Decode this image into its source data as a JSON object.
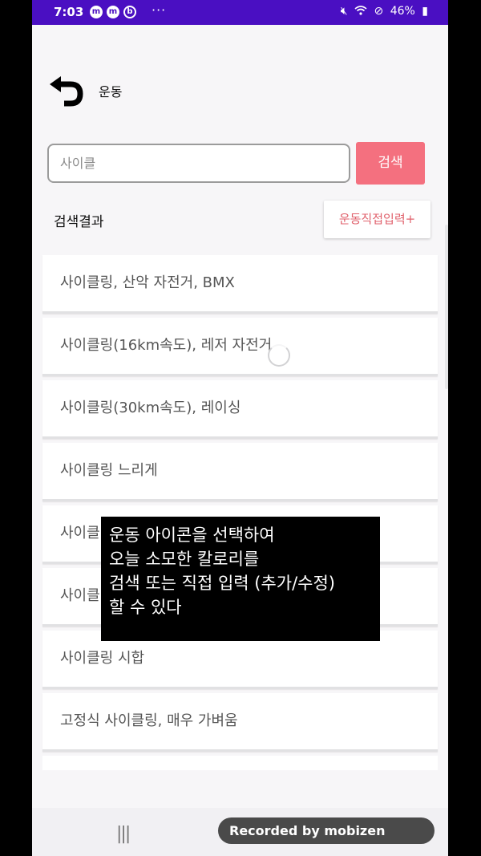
{
  "status_bar": {
    "time": "7:03",
    "notif_icons": [
      "m",
      "m",
      "b"
    ],
    "overflow": "···",
    "icons": [
      "mute-icon",
      "wifi-icon",
      "dnd-icon"
    ],
    "battery": "46%"
  },
  "header": {
    "title": "운동"
  },
  "search": {
    "value": "사이클",
    "button_label": "검색"
  },
  "results": {
    "label": "검색결과",
    "direct_input_label": "운동직접입력+",
    "items": [
      "사이클링, 산악 자전거, BMX",
      "사이클링(16km속도), 레저 자전거",
      "사이클링(30km속도), 레이싱",
      "사이클링 느리게",
      "사이클링",
      "사이클링",
      "사이클링 시합",
      "고정식 사이클링, 매우 가벼움",
      ""
    ]
  },
  "caption": {
    "lines": [
      "운동 아이콘을 선택하여",
      "오늘 소모한 칼로리를",
      "검색 또는 직접 입력 (추가/수정)",
      "할 수 있다"
    ]
  },
  "navbar": {
    "recent_glyph": "|||"
  },
  "watermark": {
    "text": "Recorded by mobizen"
  },
  "colors": {
    "status_bar": "#4a0fc2",
    "accent": "#f4707f",
    "accent_text": "#e0616c",
    "background": "#f7f6f8"
  }
}
